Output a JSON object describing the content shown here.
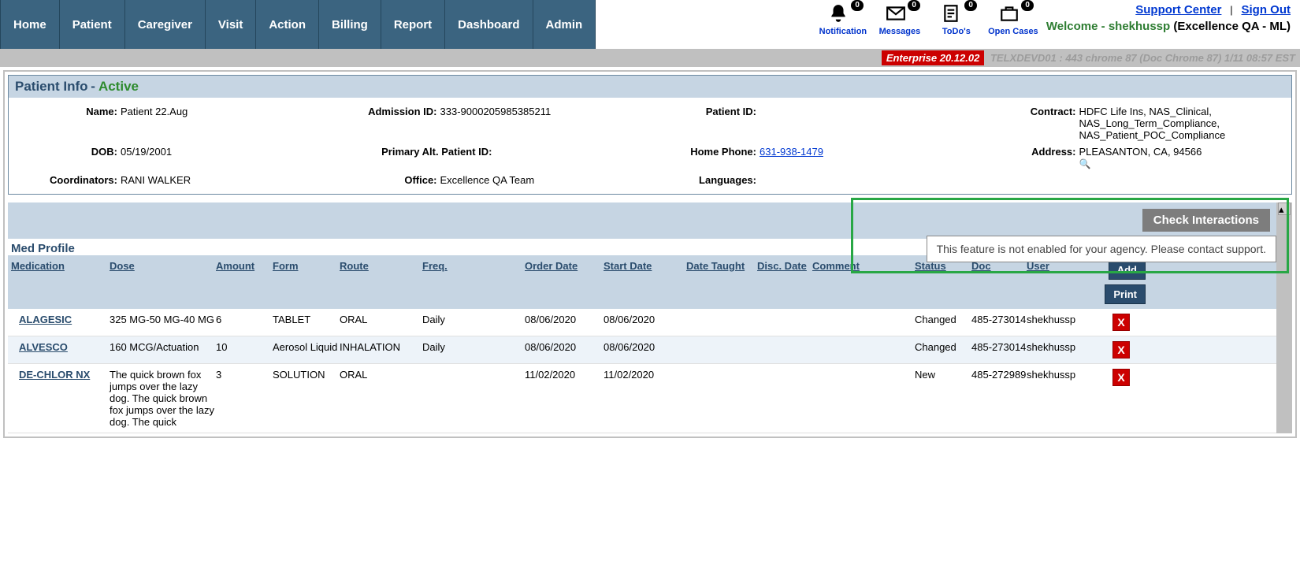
{
  "nav": [
    "Home",
    "Patient",
    "Caregiver",
    "Visit",
    "Action",
    "Billing",
    "Report",
    "Dashboard",
    "Admin"
  ],
  "top_icons": [
    {
      "name": "notification-icon",
      "label": "Notification",
      "count": "0"
    },
    {
      "name": "messages-icon",
      "label": "Messages",
      "count": "0"
    },
    {
      "name": "todos-icon",
      "label": "ToDo's",
      "count": "0"
    },
    {
      "name": "open-cases-icon",
      "label": "Open Cases",
      "count": "0"
    }
  ],
  "account": {
    "support": "Support Center",
    "signout": "Sign Out",
    "welcome_prefix": "Welcome - ",
    "user": "shekhussp",
    "org_suffix": " (Excellence QA - ML)"
  },
  "env": {
    "version": "Enterprise 20.12.02",
    "info": "TELXDEVD01 : 443 chrome 87 (Doc Chrome 87) 1/11 08:57 EST"
  },
  "patient_info": {
    "title": "Patient Info",
    "status": "Active",
    "labels": {
      "name": "Name:",
      "admission": "Admission ID:",
      "patient_id": "Patient ID:",
      "contract": "Contract:",
      "dob": "DOB:",
      "primary_alt": "Primary Alt. Patient ID:",
      "home_phone": "Home Phone:",
      "address": "Address:",
      "coordinators": "Coordinators:",
      "office": "Office:",
      "languages": "Languages:"
    },
    "values": {
      "name": "Patient 22.Aug",
      "admission": "333-9000205985385211",
      "patient_id": "",
      "contract": "HDFC Life Ins, NAS_Clinical, NAS_Long_Term_Compliance, NAS_Patient_POC_Compliance",
      "dob": "05/19/2001",
      "primary_alt": "",
      "home_phone": "631-938-1479",
      "address": "PLEASANTON, CA, 94566",
      "coordinators": "RANI WALKER",
      "office": "Excellence QA Team",
      "languages": ""
    }
  },
  "med": {
    "check_label": "Check Interactions",
    "tooltip": "This feature is not enabled for your agency. Please contact support.",
    "section_title": "Med Profile",
    "columns": [
      "Medication",
      "Dose",
      "Amount",
      "Form",
      "Route",
      "Freq.",
      "Order Date",
      "Start Date",
      "Date Taught",
      "Disc. Date",
      "Comment",
      "Status",
      "Doc",
      "User"
    ],
    "add": "Add",
    "print": "Print",
    "rows": [
      {
        "medication": "ALAGESIC",
        "dose": "325 MG-50 MG-40 MG",
        "amount": "6",
        "form": "TABLET",
        "route": "ORAL",
        "freq": "Daily",
        "order": "08/06/2020",
        "start": "08/06/2020",
        "taught": "",
        "disc": "",
        "comment": "",
        "status": "Changed",
        "doc": "485-273014",
        "user": "shekhussp"
      },
      {
        "medication": "ALVESCO",
        "dose": "160 MCG/Actuation",
        "amount": "10",
        "form": "Aerosol Liquid",
        "route": "INHALATION",
        "freq": "Daily",
        "order": "08/06/2020",
        "start": "08/06/2020",
        "taught": "",
        "disc": "",
        "comment": "",
        "status": "Changed",
        "doc": "485-273014",
        "user": "shekhussp"
      },
      {
        "medication": "DE-CHLOR NX",
        "dose": "The quick brown fox jumps over the lazy dog. The quick brown fox jumps over the lazy dog. The quick",
        "amount": "3",
        "form": "SOLUTION",
        "route": "ORAL",
        "freq": "",
        "order": "11/02/2020",
        "start": "11/02/2020",
        "taught": "",
        "disc": "",
        "comment": "",
        "status": "New",
        "doc": "485-272989",
        "user": "shekhussp"
      }
    ]
  }
}
